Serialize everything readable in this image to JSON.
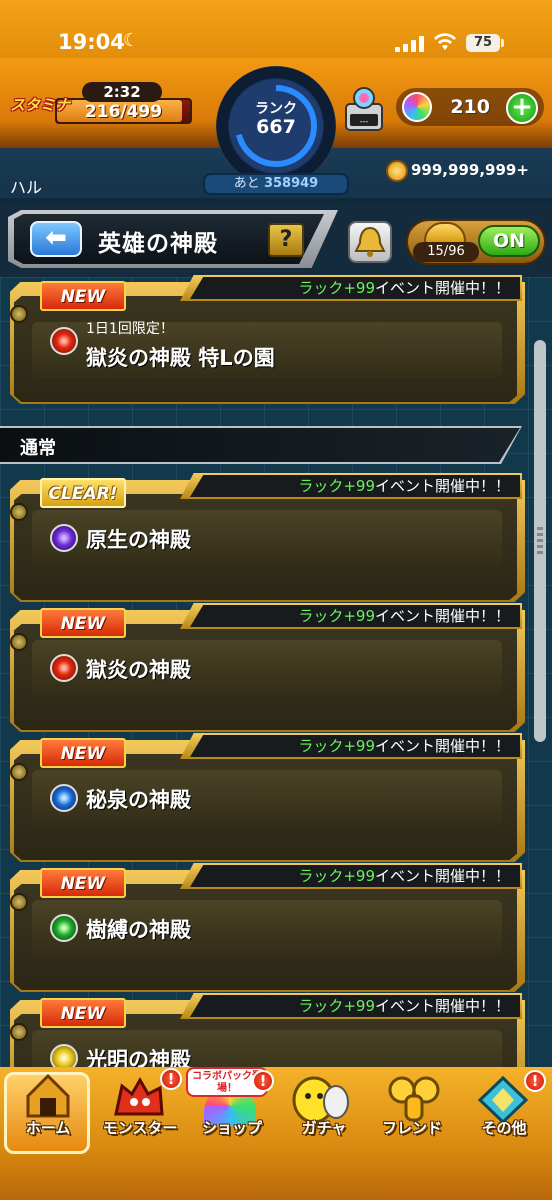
{
  "status_bar": {
    "time": "19:04",
    "battery": "75"
  },
  "header": {
    "stamina_label": "スタミナ",
    "stamina_timer": "2:32",
    "stamina_value": "216/499",
    "rank_label": "ランク",
    "rank_value": "667",
    "next_rank_prefix": "あと",
    "next_rank_value": "358949",
    "gem_machine_value": "---",
    "orb_count": "210",
    "player_name": "ハル",
    "coins": "999,999,999+"
  },
  "title_bar": {
    "title": "英雄の神殿",
    "help_label": "?",
    "lucky_count": "15/96",
    "toggle_label": "ON"
  },
  "event_text": {
    "luck": "ラック+99",
    "suffix": "イベント開催中！！"
  },
  "featured": {
    "badge": "NEW",
    "subtitle": "1日1回限定！",
    "name": "獄炎の神殿 特Lの園"
  },
  "section": {
    "label": "通常"
  },
  "temples": [
    {
      "badge": "CLEAR!",
      "name": "原生の神殿",
      "element": "dark"
    },
    {
      "badge": "NEW",
      "name": "獄炎の神殿",
      "element": "fire"
    },
    {
      "badge": "NEW",
      "name": "秘泉の神殿",
      "element": "water"
    },
    {
      "badge": "NEW",
      "name": "樹縛の神殿",
      "element": "wood"
    },
    {
      "badge": "NEW",
      "name": "光明の神殿",
      "element": "light"
    }
  ],
  "bottom_nav": {
    "collab_badge": "コラボパック登場！",
    "alert": "!",
    "items": [
      {
        "label": "ホーム"
      },
      {
        "label": "モンスター"
      },
      {
        "label": "ショップ"
      },
      {
        "label": "ガチャ"
      },
      {
        "label": "フレンド"
      },
      {
        "label": "その他"
      }
    ]
  },
  "colors": {
    "accent_orange": "#f3a316",
    "luck_green": "#6df05a",
    "badge_new": "#d62a0a",
    "on_green": "#2fa815"
  }
}
